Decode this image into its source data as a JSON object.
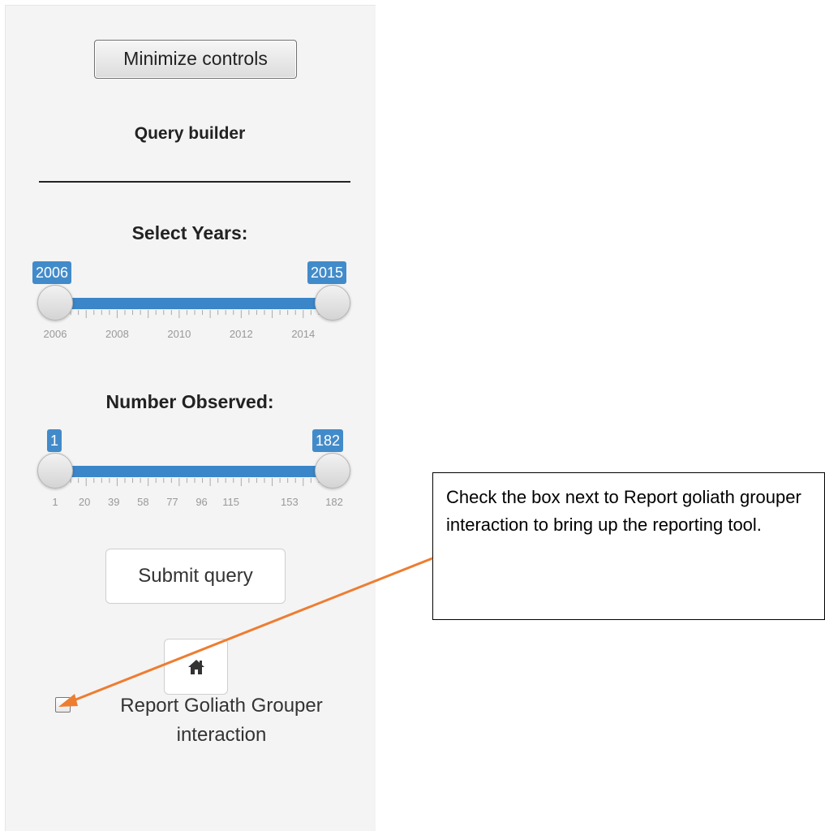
{
  "controls": {
    "minimize_label": "Minimize controls",
    "query_builder_title": "Query builder",
    "submit_label": "Submit query",
    "home_icon": "home-icon"
  },
  "years_slider": {
    "label": "Select Years:",
    "min_value": "2006",
    "max_value": "2015",
    "range": [
      2006,
      2015
    ],
    "tick_labels": [
      "2006",
      "2008",
      "2010",
      "2012",
      "2014"
    ]
  },
  "number_slider": {
    "label": "Number Observed:",
    "min_value": "1",
    "max_value": "182",
    "range": [
      1,
      182
    ],
    "tick_labels": [
      "1",
      "20",
      "39",
      "58",
      "77",
      "96",
      "115",
      "153",
      "182"
    ]
  },
  "report_checkbox": {
    "checked": false,
    "label": "Report Goliath Grouper interaction"
  },
  "callout": {
    "text": "Check the box next to Report goliath grouper interaction to bring up the reporting tool."
  },
  "colors": {
    "accent": "#3a86c8",
    "arrow": "#ed7d31"
  }
}
